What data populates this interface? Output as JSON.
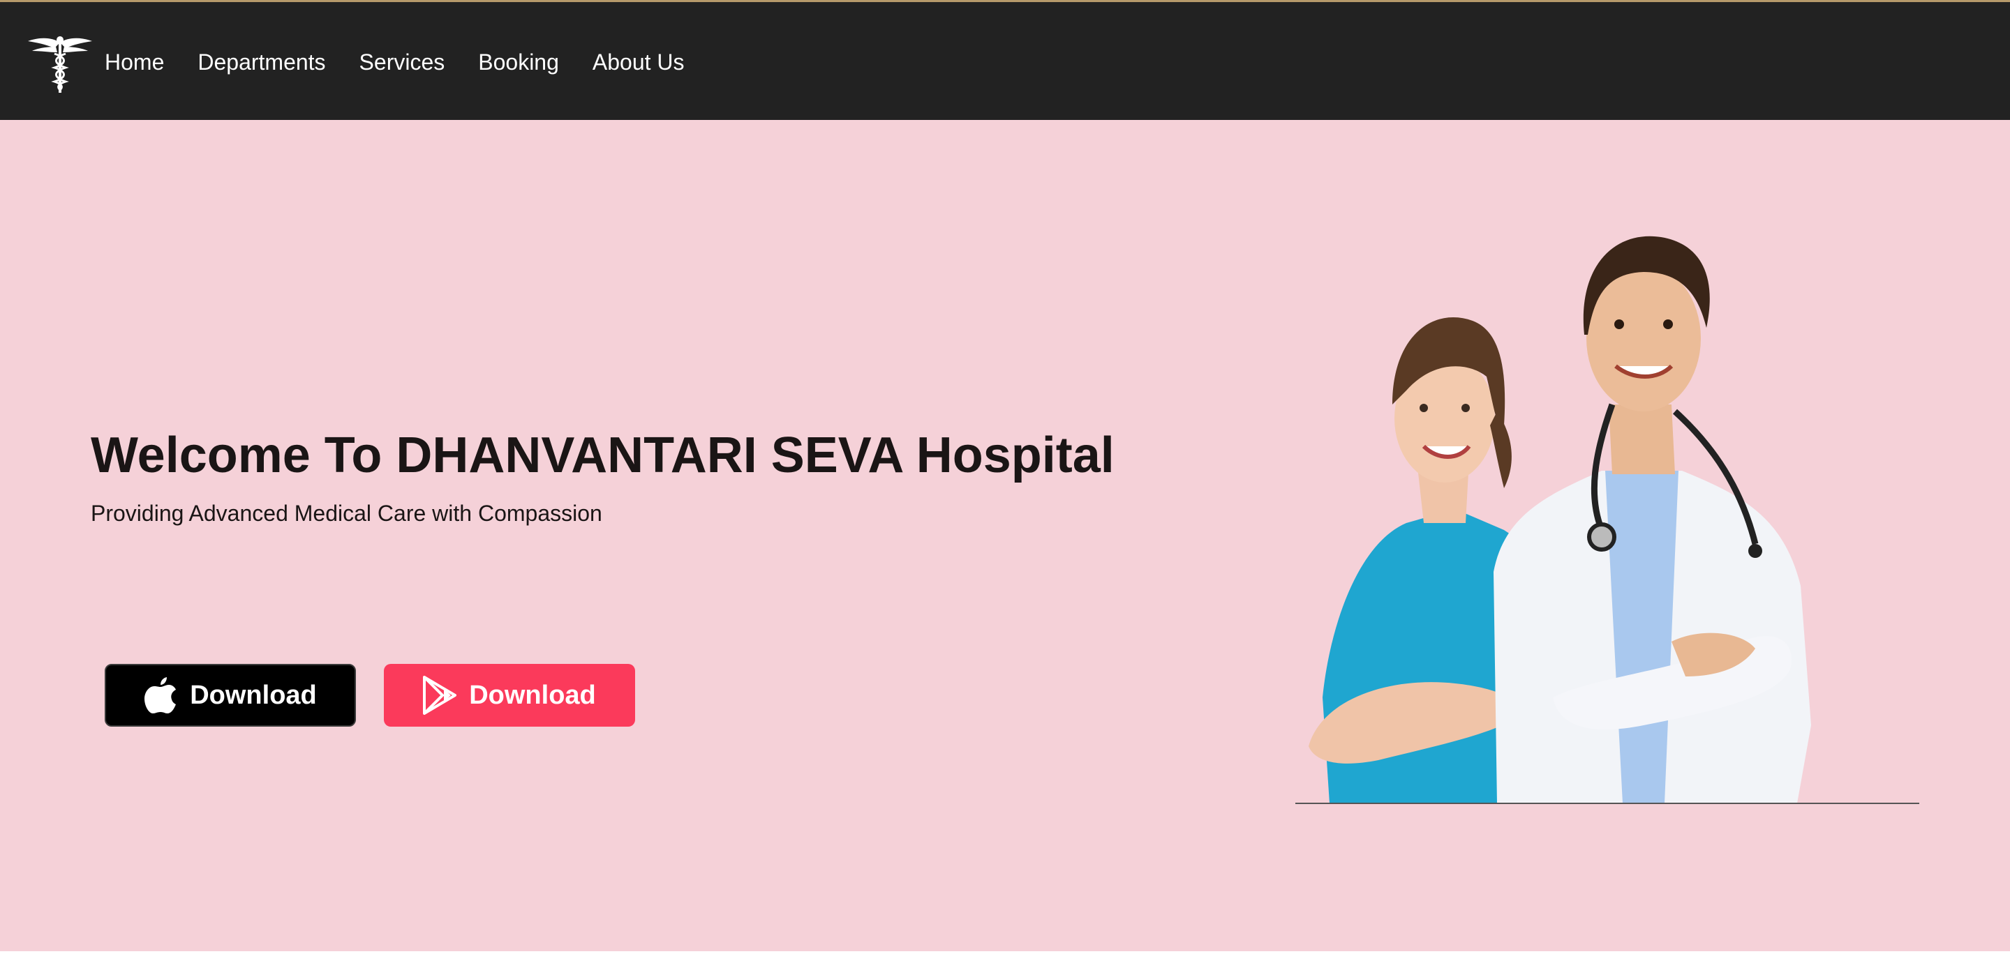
{
  "header": {
    "logo_icon": "caduceus-icon",
    "nav": [
      {
        "label": "Home"
      },
      {
        "label": "Departments"
      },
      {
        "label": "Services"
      },
      {
        "label": "Booking"
      },
      {
        "label": "About Us"
      }
    ]
  },
  "hero": {
    "title": "Welcome To DHANVANTARI SEVA Hospital",
    "subtitle": "Providing Advanced Medical Care with Compassion",
    "buttons": [
      {
        "label": "Download",
        "icon": "apple-icon",
        "color": "#000000"
      },
      {
        "label": "Download",
        "icon": "google-play-icon",
        "color": "#fb3a5b"
      }
    ],
    "image": "doctor-and-nurse-photo"
  },
  "colors": {
    "background": "#f5d1d8",
    "navbar": "#222222",
    "accent": "#fb3a5b"
  }
}
